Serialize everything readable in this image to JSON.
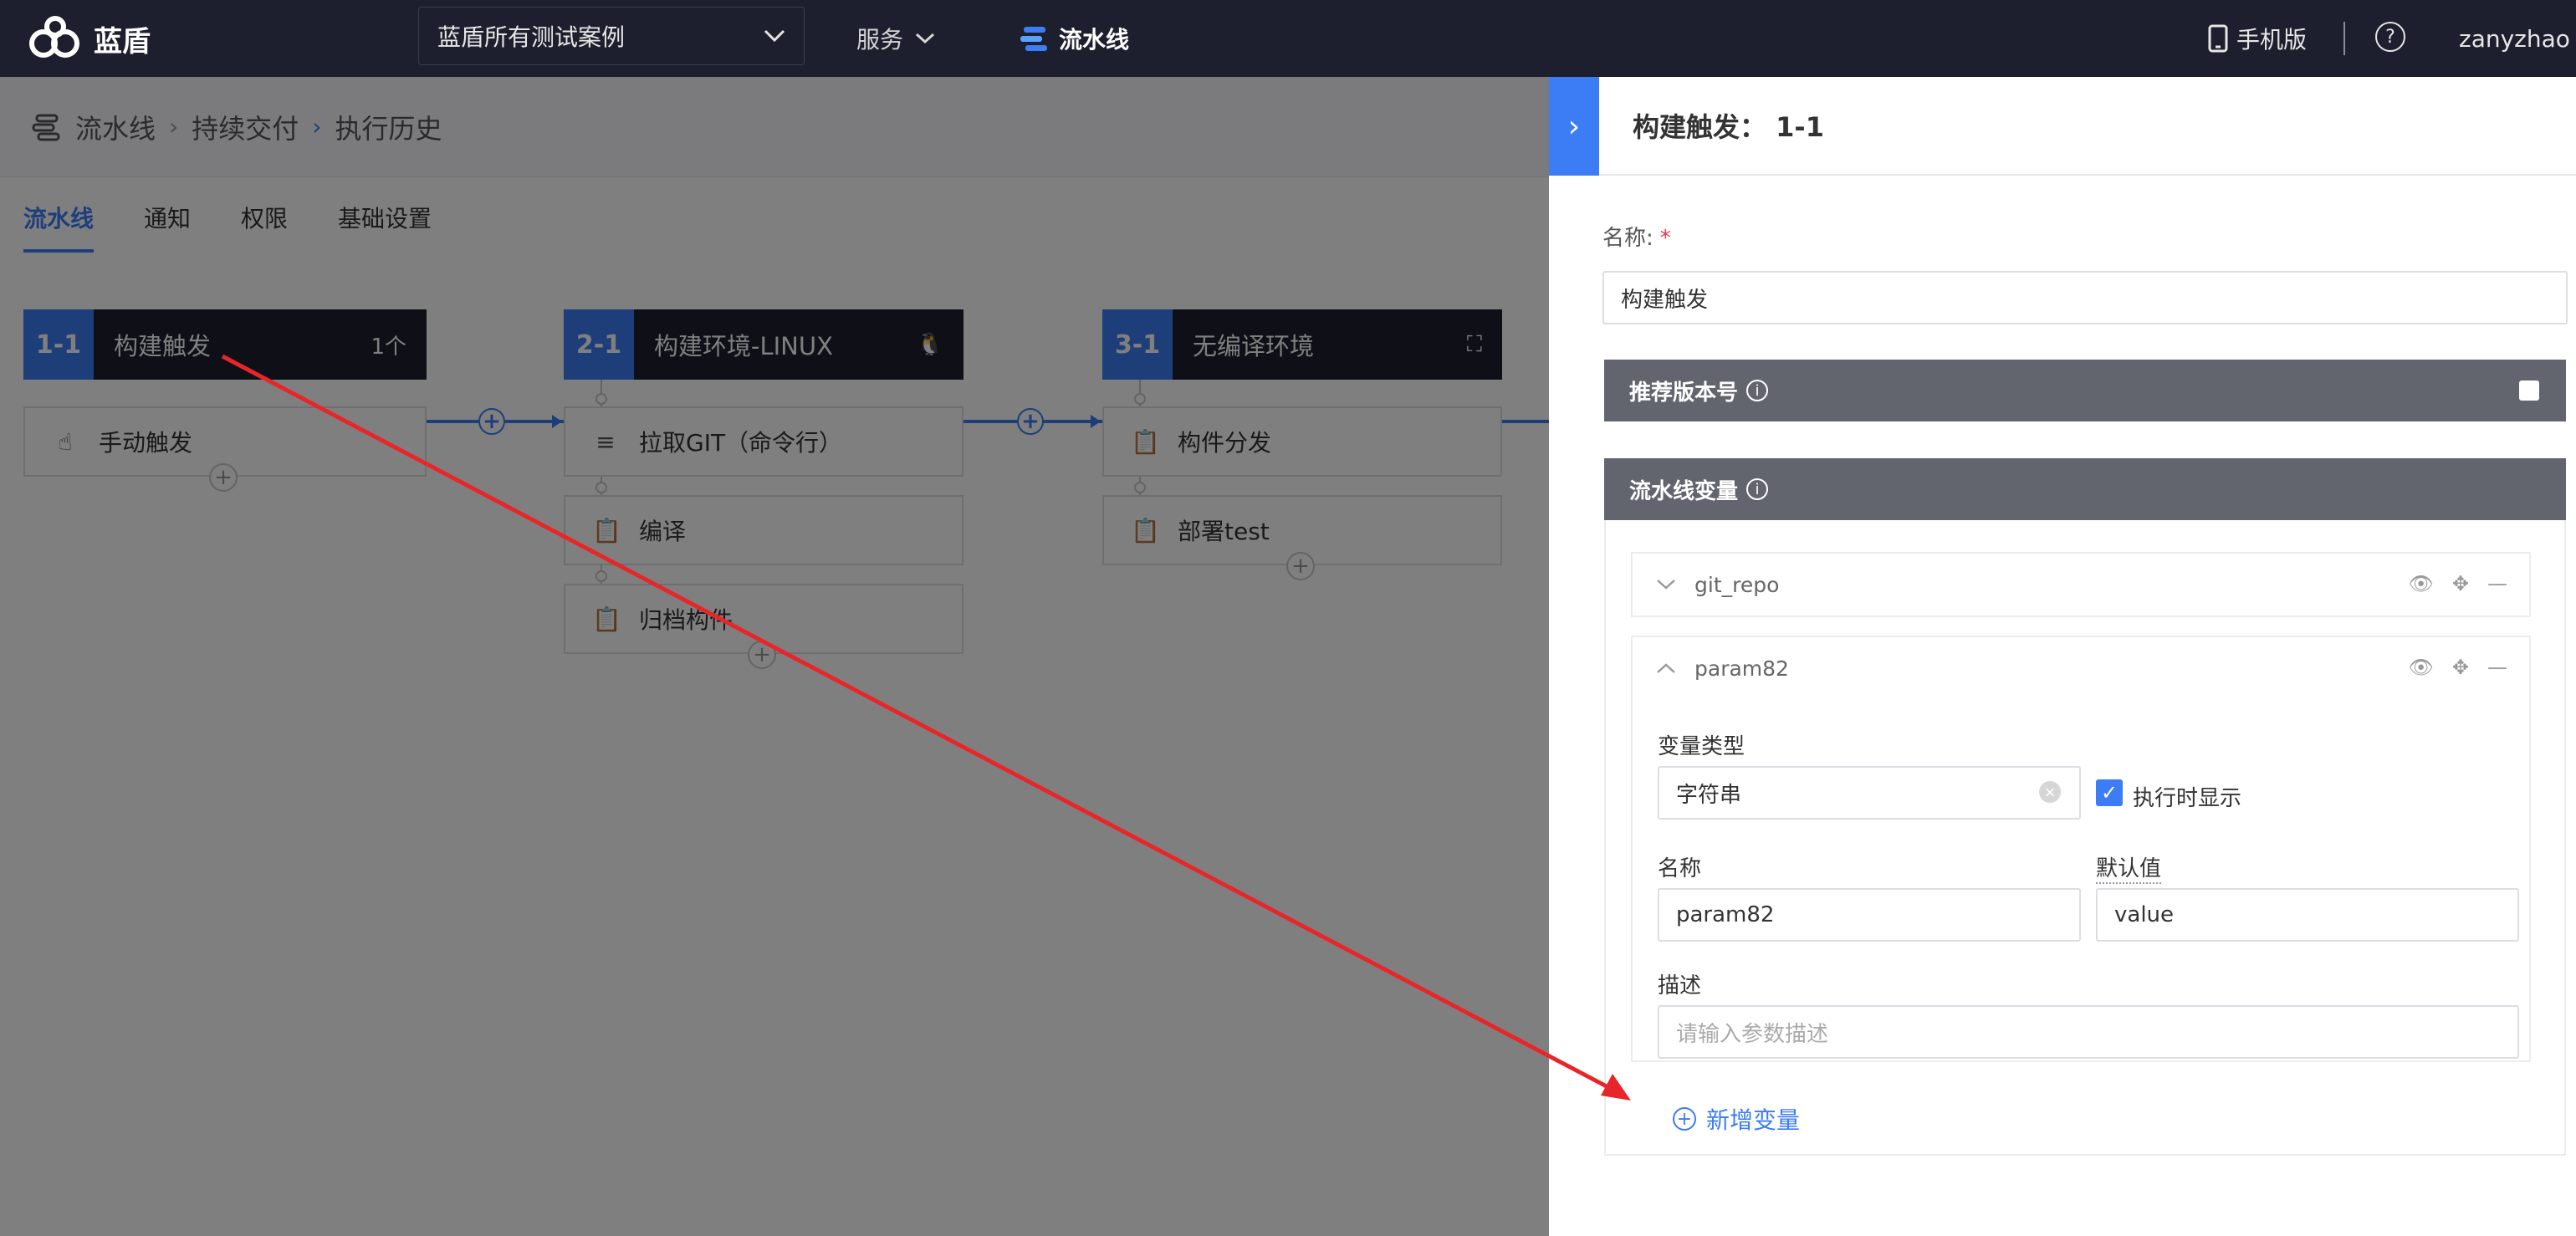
{
  "topbar": {
    "logo_text": "蓝盾",
    "project_select": "蓝盾所有测试案例",
    "service_label": "服务",
    "pipeline_label": "流水线",
    "mobile_label": "手机版",
    "help_label": "?",
    "user_label": "zanyzhao"
  },
  "breadcrumb": {
    "items": [
      "流水线",
      "持续交付",
      "执行历史"
    ]
  },
  "tabs": [
    "流水线",
    "通知",
    "权限",
    "基础设置"
  ],
  "stages": [
    {
      "num": "1-1",
      "title": "构建触发",
      "extra": "1个",
      "tasks": [
        "手动触发"
      ]
    },
    {
      "num": "2-1",
      "title": "构建环境-LINUX",
      "extra_icon": "linux-icon",
      "tasks": [
        "拉取GIT（命令行）",
        "编译",
        "归档构件"
      ]
    },
    {
      "num": "3-1",
      "title": "无编译环境",
      "extra_icon": "expand-icon",
      "tasks": [
        "构件分发",
        "部署test"
      ]
    }
  ],
  "drawer": {
    "toggle_icon": "›",
    "title": "构建触发：  1-1",
    "name_label": "名称:",
    "name_required": "*",
    "name_value": "构建触发",
    "recommend_version_label": "推荐版本号",
    "pipeline_vars_label": "流水线变量",
    "vars": [
      {
        "name": "git_repo",
        "expanded": false
      },
      {
        "name": "param82",
        "expanded": true,
        "type_label": "变量类型",
        "type_value": "字符串",
        "show_on_run_label": "执行时显示",
        "show_on_run_checked": true,
        "name_label": "名称",
        "name_value": "param82",
        "default_label": "默认值",
        "default_value": "value",
        "desc_label": "描述",
        "desc_placeholder": "请输入参数描述"
      }
    ],
    "add_var_label": "新增变量"
  },
  "colors": {
    "primary": "#3c7cf5",
    "topbar": "#1d1f2e",
    "section_bar": "#63656e",
    "annotation_arrow": "#e8262a"
  }
}
